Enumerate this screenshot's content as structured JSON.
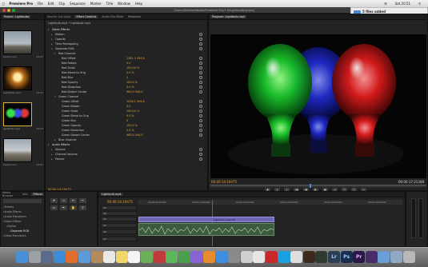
{
  "menubar": {
    "apple": "",
    "app": "Premiere Pro",
    "items": [
      "File",
      "Edit",
      "Clip",
      "Sequence",
      "Marker",
      "Title",
      "Window",
      "Help"
    ],
    "clock": "Sat 20:51"
  },
  "titlebar": {
    "text": "/Users/Shared/Adobe/Premiere Pro/7.0/Lightbulbs.prproj"
  },
  "notification": {
    "title": "5 files added",
    "subtitle": "5 files were added to your Dropbox"
  },
  "project": {
    "tabs": [
      "Project: Lightbulbs"
    ],
    "clips": [
      {
        "name": "beach.mov",
        "duration": "03:07"
      },
      {
        "name": "LightBulb.mp4",
        "duration": "03:07"
      },
      {
        "name": "lightbulb.mp4",
        "duration": "22:03"
      },
      {
        "name": "beach.mov",
        "duration": "03:07"
      }
    ]
  },
  "effects": {
    "tabs": [
      "Source: (no clips)",
      "Effect Controls",
      "Audio Clip Mixer",
      "Metadata"
    ],
    "header": "Lightbulb.mp4 * Lightbulb.mp4",
    "rows": [
      {
        "label": "Video Effects",
        "value": "",
        "indent": 0,
        "tri": "open"
      },
      {
        "label": "Motion",
        "value": "",
        "indent": 1,
        "tri": "closed"
      },
      {
        "label": "Opacity",
        "value": "",
        "indent": 1,
        "tri": "closed"
      },
      {
        "label": "Time Remapping",
        "value": "",
        "indent": 1,
        "tri": "closed"
      },
      {
        "label": "Separate RGB",
        "value": "",
        "indent": 1,
        "tri": "open"
      },
      {
        "label": "Red Channel",
        "value": "",
        "indent": 2,
        "tri": "open"
      },
      {
        "label": "Red Offset",
        "value": "1381.3  394.8",
        "indent": 3,
        "tri": "none"
      },
      {
        "label": "Red Rotate",
        "value": "0.0",
        "indent": 3,
        "tri": "none"
      },
      {
        "label": "Red Scale",
        "value": "100.00 %",
        "indent": 3,
        "tri": "none"
      },
      {
        "label": "Red Blend to Orig",
        "value": "0.0 %",
        "indent": 3,
        "tri": "none"
      },
      {
        "label": "Red Blur",
        "value": "0",
        "indent": 3,
        "tri": "none"
      },
      {
        "label": "Red Opacity",
        "value": "100.0 %",
        "indent": 3,
        "tri": "none"
      },
      {
        "label": "Red Distortion",
        "value": "0.0 %",
        "indent": 3,
        "tri": "none"
      },
      {
        "label": "Red Distort Center",
        "value": "960.0  540.0",
        "indent": 3,
        "tri": "none"
      },
      {
        "label": "Green Channel",
        "value": "",
        "indent": 2,
        "tri": "open"
      },
      {
        "label": "Green Offset",
        "value": "1058.1  394.8",
        "indent": 3,
        "tri": "none"
      },
      {
        "label": "Green Rotate",
        "value": "0.0",
        "indent": 3,
        "tri": "none"
      },
      {
        "label": "Green Scale",
        "value": "100.00 %",
        "indent": 3,
        "tri": "none"
      },
      {
        "label": "Green Blend to Orig",
        "value": "0.0 %",
        "indent": 3,
        "tri": "none"
      },
      {
        "label": "Green Blur",
        "value": "0",
        "indent": 3,
        "tri": "none"
      },
      {
        "label": "Green Opacity",
        "value": "100.0 %",
        "indent": 3,
        "tri": "none"
      },
      {
        "label": "Green Distortion",
        "value": "0.0 %",
        "indent": 3,
        "tri": "none"
      },
      {
        "label": "Green Distort Center",
        "value": "960.0  540.0",
        "indent": 3,
        "tri": "none"
      },
      {
        "label": "Blue Channel",
        "value": "",
        "indent": 2,
        "tri": "closed"
      },
      {
        "label": "Audio Effects",
        "value": "",
        "indent": 0,
        "tri": "open"
      },
      {
        "label": "Volume",
        "value": "",
        "indent": 1,
        "tri": "closed"
      },
      {
        "label": "Channel Volume",
        "value": "",
        "indent": 1,
        "tri": "closed"
      },
      {
        "label": "Panner",
        "value": "",
        "indent": 1,
        "tri": "closed"
      }
    ],
    "timecode": "00:00:14:19475"
  },
  "program": {
    "tab": "Program: Lightbulb.mp4",
    "timecode_left": "00:00:14:19475",
    "timecode_right": "00:00:17:21348",
    "transport": [
      "◆",
      "{",
      "}",
      "|◀",
      "◀|",
      "▶",
      "|▶",
      "⇥",
      "☐",
      "☐",
      "+"
    ]
  },
  "media": {
    "tabs": [
      "Media Browser",
      "Info",
      "Effects"
    ],
    "items": [
      "Presets",
      "Audio Effects",
      "Audio Transitions",
      "Video Effects",
      "Stylize",
      "Separate RGB",
      "Video Transitions"
    ]
  },
  "timeline": {
    "tab": "Lightbulb.mp4",
    "timecode": "00:00:14:19475",
    "ruler": [
      "00:00:05:00000",
      "00:00:10:00000",
      "00:00:15:00000",
      "00:00:20:00000",
      "00:00:25:00000",
      "00:00:30:00000"
    ],
    "tracks": [
      "V3",
      "V2",
      "V1",
      "A1",
      "A2",
      "A3"
    ],
    "clip_name": "Lightbulb.mp4 [V]"
  },
  "dock": {
    "icons": [
      {
        "name": "finder-icon",
        "color": "#4a90d9"
      },
      {
        "name": "launchpad-icon",
        "color": "#9aa0a6"
      },
      {
        "name": "mission-control-icon",
        "color": "#5b6b8c"
      },
      {
        "name": "safari-icon",
        "color": "#3a8bd8"
      },
      {
        "name": "firefox-icon",
        "color": "#e06d2b"
      },
      {
        "name": "mail-icon",
        "color": "#5d9bd8"
      },
      {
        "name": "contacts-icon",
        "color": "#b38b5c"
      },
      {
        "name": "calendar-icon",
        "color": "#e9e9e9"
      },
      {
        "name": "notes-icon",
        "color": "#f1d668"
      },
      {
        "name": "reminders-icon",
        "color": "#f5f5f5"
      },
      {
        "name": "maps-icon",
        "color": "#6db05b"
      },
      {
        "name": "photo-booth-icon",
        "color": "#c23b3b"
      },
      {
        "name": "messages-icon",
        "color": "#5cb85c"
      },
      {
        "name": "facetime-icon",
        "color": "#4aa04a"
      },
      {
        "name": "itunes-icon",
        "color": "#8a63d2"
      },
      {
        "name": "ibooks-icon",
        "color": "#e88b2c"
      },
      {
        "name": "app-store-icon",
        "color": "#3f8de0"
      },
      {
        "name": "preferences-icon",
        "color": "#8a8a8a"
      },
      {
        "name": "script-icon",
        "color": "#cfcfcf"
      },
      {
        "name": "text-edit-icon",
        "color": "#e6e6e6"
      },
      {
        "name": "acrobat-icon",
        "color": "#c8282a"
      },
      {
        "name": "skype-icon",
        "color": "#18a0e0"
      },
      {
        "name": "clock-icon",
        "color": "#dedede"
      },
      {
        "name": "bridge-icon",
        "color": "#3d2a1c"
      },
      {
        "name": "activity-monitor-icon",
        "color": "#2e3b2e"
      },
      {
        "name": "lightroom-icon",
        "color": "#2b3d52"
      },
      {
        "name": "photoshop-icon",
        "color": "#1b2d4d"
      },
      {
        "name": "premiere-icon",
        "color": "#2b1747"
      },
      {
        "name": "media-encoder-icon",
        "color": "#4b2a6a"
      },
      {
        "name": "downloads-icon",
        "color": "#6aa0d8"
      },
      {
        "name": "documents-icon",
        "color": "#8fa8c4"
      },
      {
        "name": "trash-icon",
        "color": "#b8b8b8"
      }
    ],
    "text_icons": {
      "lightroom": "Lr",
      "photoshop": "Ps",
      "premiere": "Pr"
    }
  }
}
